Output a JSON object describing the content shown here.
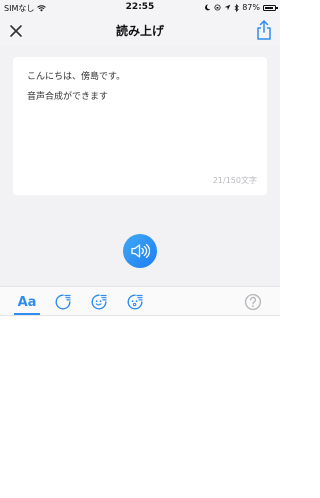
{
  "status_bar": {
    "carrier": "SIMなし",
    "time": "22:55",
    "battery": "87%",
    "battery_level": 0.87
  },
  "nav": {
    "title": "読み上げ",
    "close_icon": "close-icon",
    "share_icon": "share-icon"
  },
  "editor": {
    "lines": [
      "こんにちは、傍島です。",
      "音声合成ができます"
    ],
    "char_count": "21/150文字"
  },
  "toolbar": {
    "font_label": "Aa",
    "items": [
      "speed-icon",
      "voice-happy-icon",
      "voice-emotion-icon",
      "help-icon"
    ]
  },
  "colors": {
    "accent": "#2f8cf0",
    "background": "#f2f2f4"
  }
}
